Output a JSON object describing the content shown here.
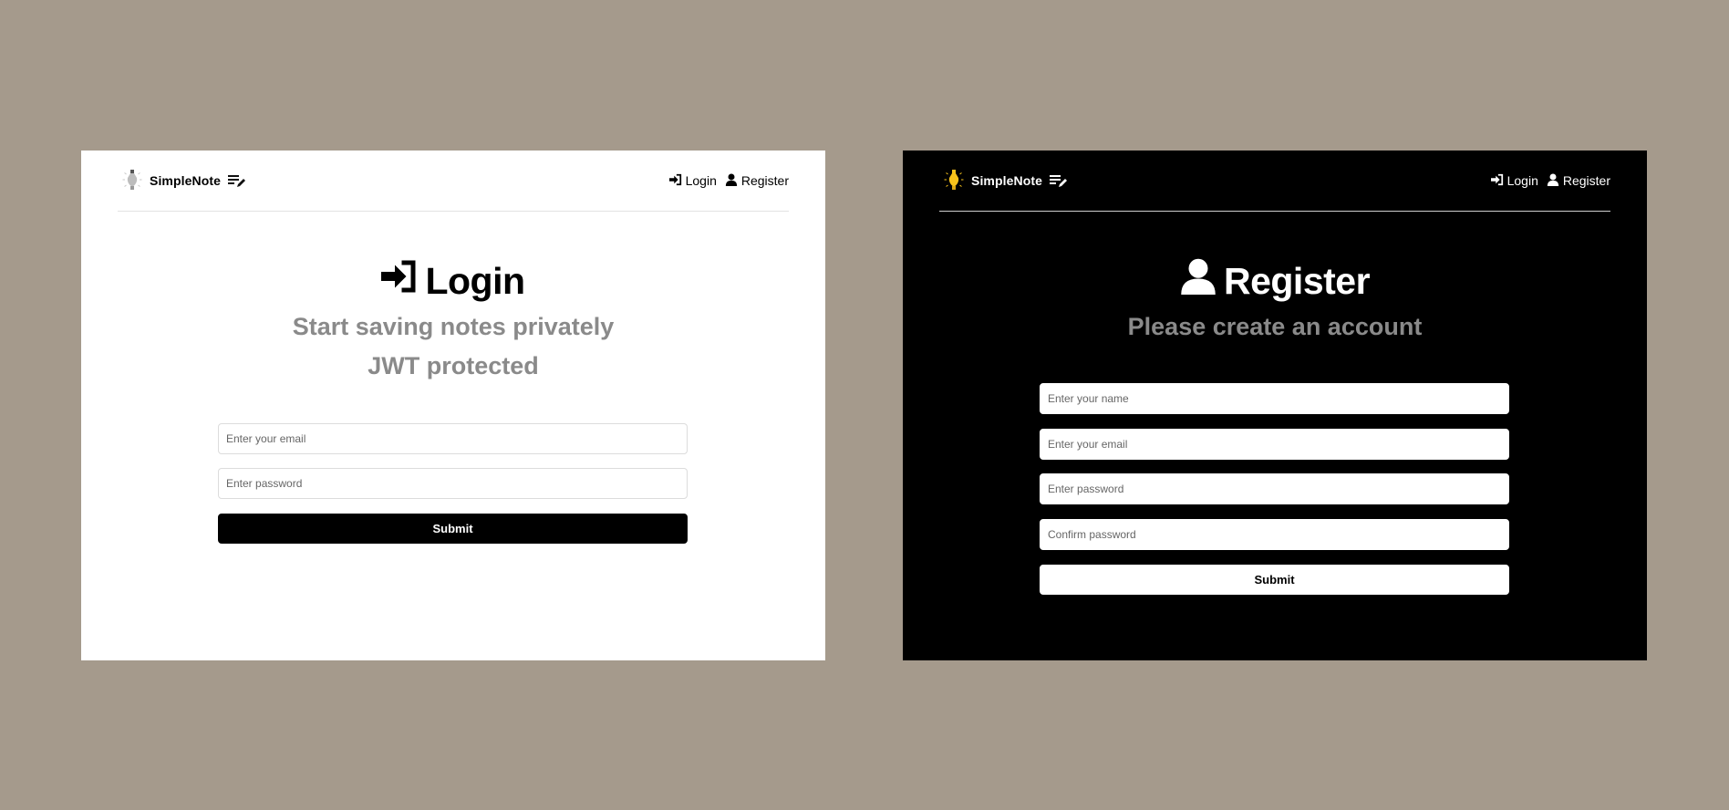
{
  "login_panel": {
    "brand": {
      "name": "SimpleNote",
      "bulb_icon": "lightbulb-off-icon",
      "note_icon": "note-edit-icon"
    },
    "nav": {
      "login": {
        "label": "Login",
        "icon": "sign-in-icon"
      },
      "register": {
        "label": "Register",
        "icon": "user-icon"
      }
    },
    "heading": {
      "icon": "sign-in-icon",
      "title": "Login"
    },
    "subtitle_1": "Start saving notes privately",
    "subtitle_2": "JWT protected",
    "form": {
      "email_placeholder": "Enter your email",
      "password_placeholder": "Enter password",
      "submit_label": "Submit"
    },
    "colors": {
      "background": "#ffffff",
      "text": "#000000",
      "subtitle": "#8a8a8a",
      "button": "#000000"
    }
  },
  "register_panel": {
    "brand": {
      "name": "SimpleNote",
      "bulb_icon": "lightbulb-on-icon",
      "note_icon": "note-edit-icon"
    },
    "nav": {
      "login": {
        "label": "Login",
        "icon": "sign-in-icon"
      },
      "register": {
        "label": "Register",
        "icon": "user-icon"
      }
    },
    "heading": {
      "icon": "user-icon",
      "title": "Register"
    },
    "subtitle": "Please create an account",
    "form": {
      "name_placeholder": "Enter your name",
      "email_placeholder": "Enter your email",
      "password_placeholder": "Enter password",
      "confirm_placeholder": "Confirm password",
      "submit_label": "Submit"
    },
    "colors": {
      "background": "#000000",
      "text": "#ffffff",
      "subtitle": "#8a8a8a",
      "button": "#ffffff",
      "bulb": "#f7c21b"
    }
  },
  "page": {
    "background": "#a59a8c"
  }
}
